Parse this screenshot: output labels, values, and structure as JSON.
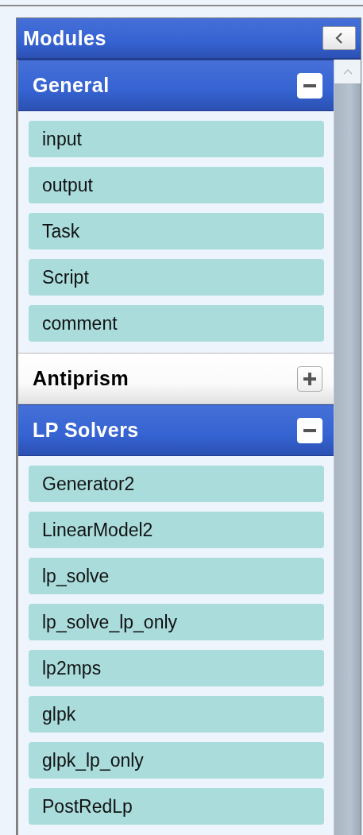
{
  "panel": {
    "title": "Modules"
  },
  "groups": [
    {
      "title": "General",
      "expanded": true,
      "items": [
        "input",
        "output",
        "Task",
        "Script",
        "comment"
      ]
    },
    {
      "title": "Antiprism",
      "expanded": false
    },
    {
      "title": "LP Solvers",
      "expanded": true,
      "items": [
        "Generator2",
        "LinearModel2",
        "lp_solve",
        "lp_solve_lp_only",
        "lp2mps",
        "glpk",
        "glpk_lp_only",
        "PostRedLp"
      ]
    }
  ]
}
